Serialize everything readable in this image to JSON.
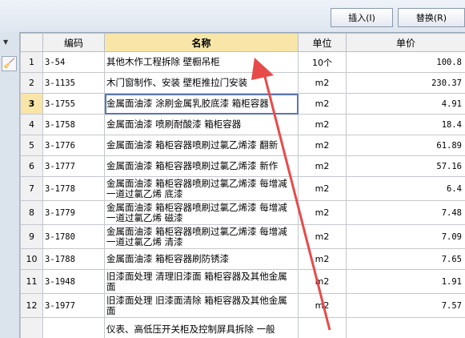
{
  "toolbar": {
    "insert_label": "插入(I)",
    "replace_label": "替换(R)"
  },
  "table": {
    "headers": [
      "编码",
      "名称",
      "单位",
      "单价"
    ],
    "rows": [
      {
        "n": "1",
        "code": "3-54",
        "name": "其他木作工程拆除 壁橱吊柜",
        "unit": "10个",
        "price": "100.8"
      },
      {
        "n": "2",
        "code": "3-1135",
        "name": "木门窗制作、安装 壁柜推拉门安装",
        "unit": "m2",
        "price": "230.37"
      },
      {
        "n": "3",
        "code": "3-1755",
        "name": "金属面油漆 涂刷金属乳胶底漆 箱柜容器",
        "unit": "m2",
        "price": "4.91"
      },
      {
        "n": "4",
        "code": "3-1758",
        "name": "金属面油漆 喷刷耐酸漆 箱柜容器",
        "unit": "m2",
        "price": "18.4"
      },
      {
        "n": "5",
        "code": "3-1776",
        "name": "金属面油漆 箱柜容器喷刷过氯乙烯漆 翻新",
        "unit": "m2",
        "price": "61.89"
      },
      {
        "n": "6",
        "code": "3-1777",
        "name": "金属面油漆 箱柜容器喷刷过氯乙烯漆 新作",
        "unit": "m2",
        "price": "57.16"
      },
      {
        "n": "7",
        "code": "3-1778",
        "name": "金属面油漆 箱柜容器喷刷过氯乙烯漆 每增减一道过氯乙烯 底漆",
        "unit": "m2",
        "price": "6.4"
      },
      {
        "n": "8",
        "code": "3-1779",
        "name": "金属面油漆 箱柜容器喷刷过氯乙烯漆 每增减一道过氯乙烯 磁漆",
        "unit": "m2",
        "price": "7.48"
      },
      {
        "n": "9",
        "code": "3-1780",
        "name": "金属面油漆 箱柜容器喷刷过氯乙烯漆 每增减一道过氯乙烯 清漆",
        "unit": "m2",
        "price": "7.09"
      },
      {
        "n": "10",
        "code": "3-1788",
        "name": "金属面油漆 箱柜容器刷防锈漆",
        "unit": "m2",
        "price": "7.65"
      },
      {
        "n": "11",
        "code": "3-1948",
        "name": "旧漆面处理 清理旧漆面 箱柜容器及其他金属面",
        "unit": "m2",
        "price": "1.91"
      },
      {
        "n": "12",
        "code": "3-1977",
        "name": "旧漆面处理 旧漆面清除 箱柜容器及其他金属面",
        "unit": "m2",
        "price": "7.57"
      },
      {
        "n": "",
        "code": "",
        "name": "仪表、高低压开关柜及控制屏具拆除 一般",
        "unit": "",
        "price": ""
      }
    ]
  },
  "colors": {
    "accent_arrow": "#e84a4a",
    "selected_header": "#f7e6a8"
  },
  "icons": {
    "dropdown": "chevron-down-icon",
    "broom": "broom-icon"
  }
}
